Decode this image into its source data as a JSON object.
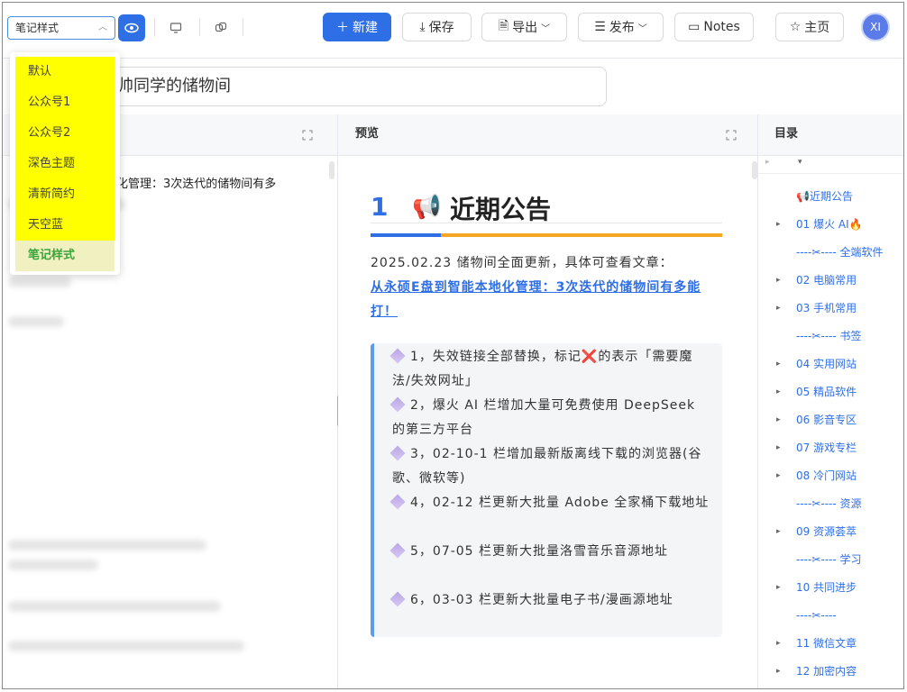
{
  "toolbar": {
    "style_select": "笔记样式",
    "new_label": "新建",
    "save_label": "保存",
    "export_label": "导出",
    "publish_label": "发布",
    "notes_label": "Notes",
    "home_label": "主页",
    "avatar_initials": "XI"
  },
  "style_dropdown": {
    "items": [
      "默认",
      "公众号1",
      "公众号2",
      "深色主题",
      "清新简约",
      "天空蓝",
      "笔记样式"
    ],
    "selected": "笔记样式"
  },
  "title_input": "帅同学的储物间",
  "editor": {
    "line1": "y化管理：3次迭代的储物间有多",
    "line1_visible": "化管理：3次迭代的储物间有多"
  },
  "preview": {
    "header": "预览",
    "h1_number": "1",
    "h1_emoji": "📢",
    "h1_text": "近期公告",
    "date_text": "2025.02.23 储物间全面更新，具体可查看文章：",
    "link_text": "从永硕E盘到智能本地化管理：3次迭代的储物间有多能打！",
    "items": [
      "1，失效链接全部替换，标记",
      "的表示「需要魔法/失效网址」",
      "2，爆火 AI 栏增加大量可免费使用 DeepSeek 的第三方平台",
      "3，02-10-1 栏增加最新版离线下载的浏览器(谷歌、微软等)",
      "4，02-12 栏更新大批量 Adobe 全家桶下载地址",
      "5，07-05 栏更新大批量洛雪音乐音源地址",
      "6，03-03 栏更新大批量电子书/漫画源地址"
    ],
    "x_mark": "❌"
  },
  "toc": {
    "header": "目录",
    "items": [
      {
        "label": "📢近期公告",
        "tri": ""
      },
      {
        "label": "01 爆火 AI🔥",
        "tri": "▸"
      },
      {
        "label": "----✂---- 全端软件",
        "tri": ""
      },
      {
        "label": "02 电脑常用",
        "tri": "▸"
      },
      {
        "label": "03 手机常用",
        "tri": "▸"
      },
      {
        "label": "----✂---- 书签",
        "tri": ""
      },
      {
        "label": "04 实用网站",
        "tri": "▸"
      },
      {
        "label": "05 精品软件",
        "tri": "▸"
      },
      {
        "label": "06 影音专区",
        "tri": "▸"
      },
      {
        "label": "07 游戏专栏",
        "tri": "▸"
      },
      {
        "label": "08 冷门网站",
        "tri": "▸"
      },
      {
        "label": "----✂---- 资源",
        "tri": ""
      },
      {
        "label": "09 资源荟萃",
        "tri": "▸"
      },
      {
        "label": "----✂---- 学习",
        "tri": ""
      },
      {
        "label": "10 共同进步",
        "tri": "▸"
      },
      {
        "label": "----✂----",
        "tri": ""
      },
      {
        "label": "11 微信文章",
        "tri": "▸"
      },
      {
        "label": "12 加密内容",
        "tri": "▸"
      }
    ]
  }
}
